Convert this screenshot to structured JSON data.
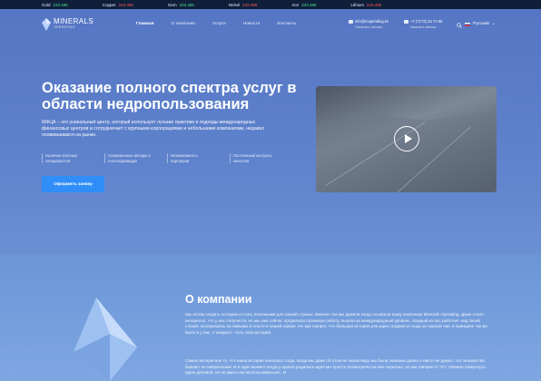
{
  "ticker": [
    {
      "name": "Gold",
      "value": "243.485",
      "dir": "up"
    },
    {
      "name": "Copper",
      "value": "243.485",
      "dir": "dn"
    },
    {
      "name": "Gem",
      "value": "243.485",
      "dir": "up"
    },
    {
      "name": "Nickel",
      "value": "243.485",
      "dir": "dn"
    },
    {
      "name": "Iron",
      "value": "243.485",
      "dir": "up"
    },
    {
      "name": "Lithium",
      "value": "243.485",
      "dir": "dn"
    }
  ],
  "logo": {
    "title": "MINERALS",
    "sub": "OPERATING"
  },
  "nav": [
    "Главная",
    "О компании",
    "Услуги",
    "Новости",
    "Контакты"
  ],
  "contact_email": {
    "value": "info@mopending.kz",
    "sub": "Написать письмо"
  },
  "contact_phone": {
    "value": "+7 (7172) 24 73 86",
    "sub": "Заказать звонок"
  },
  "lang": "Русский",
  "hero": {
    "title": "Оказание полного спектра услуг в области недропользования",
    "lead": "МФЦА – это уникальный центр, который использует лучшие практики и подходы международных финансовых центров и сотрудничает с крупными корпорациями и небольшими компаниями, недавно появившимися на рынке.",
    "features": [
      "Наличие опытных специалистов",
      "Современные методы в геологоразведке",
      "Независимость партнеров",
      "Постоянный контроль качества"
    ],
    "cta": "Оформить заявку"
  },
  "about": {
    "title": "О компании",
    "p1": "Мы хотим создать историю и стать полезными для нашей страны. Именно так мы думали когда основали нашу компанию Minerals Operating. Даже стало интересно, что у нас получится, но мы уже сейчас проделали огромную работу, вышли на международный уровень. Каждый из нас работает над своей стезей, основываясь на навыках в опыте в нашей сфере. Не зря говорят, что большая история или идея создаются сюда за чашкой чая, в принципе так же было и у нас. У каждого - есть своя история.",
    "p2": "Самое интересное то, что наша история началась тогда, когда мы даже об этом не знали ведь мы были знакомы давно и никто не думал, что знакомство бывают не напрасными. И в один момент когда у одного родилась идея мы просто посмотрели на нее серьезно, но как говорил Л. Отт «Можно отвергнуть идею деловой, но не уметь ею воспользоваться». И"
  }
}
